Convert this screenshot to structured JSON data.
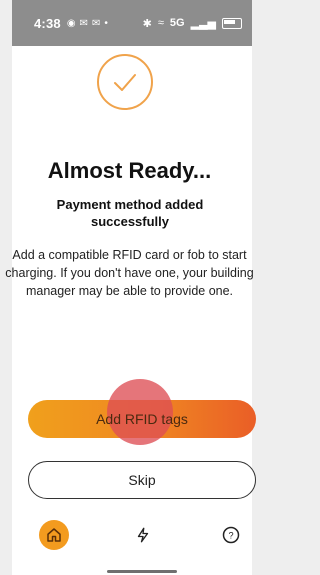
{
  "status_bar": {
    "time": "4:38",
    "left_icons": [
      "whatsapp-icon",
      "mail-icon",
      "mail-icon",
      "dot"
    ],
    "network": "5G",
    "right_icons": [
      "bluetooth-icon",
      "nfc-icon",
      "signal-icon",
      "battery-icon"
    ]
  },
  "hero": {
    "icon": "check-circle-icon",
    "accent_color": "#f0a34b"
  },
  "content": {
    "title": "Almost Ready...",
    "subtitle": "Payment method added successfully",
    "body": "Add a compatible RFID card or fob to start charging. If you don't have one, your building manager may be able to provide one."
  },
  "actions": {
    "primary_label": "Add RFID tags",
    "secondary_label": "Skip",
    "primary_gradient": [
      "#f0a01c",
      "#ef8622",
      "#ea5e27"
    ]
  },
  "tabs": [
    {
      "icon": "home-icon",
      "active": true
    },
    {
      "icon": "bolt-icon",
      "active": false
    },
    {
      "icon": "help-icon",
      "active": false
    }
  ]
}
